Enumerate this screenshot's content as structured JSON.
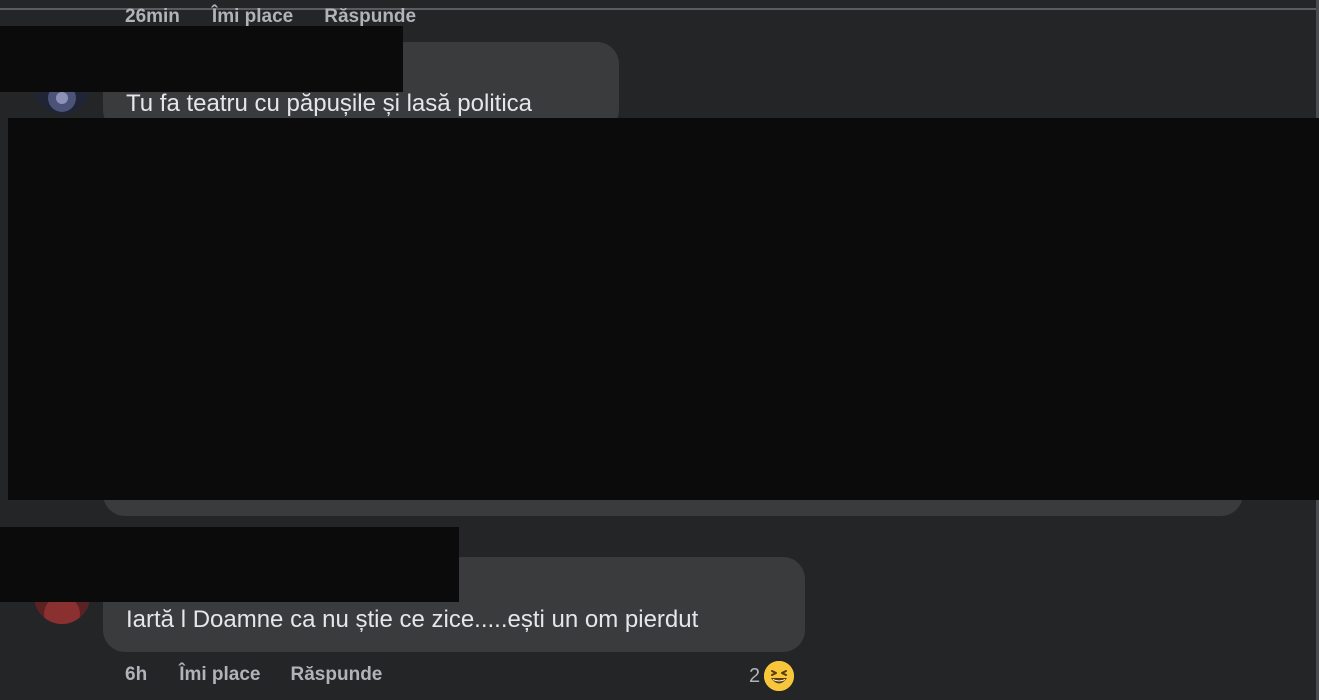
{
  "comment1": {
    "time": "26min",
    "like_label": "Îmi place",
    "reply_label": "Răspunde"
  },
  "comment2": {
    "text": "Tu fa teatru cu păpușile și lasă politica"
  },
  "comment3": {
    "text": "Iartă l Doamne ca nu știe ce zice.....ești un om pierdut",
    "time": "6h",
    "like_label": "Îmi place",
    "reply_label": "Răspunde",
    "reaction_count": "2",
    "reaction_icon": "laughing-emoji-icon"
  },
  "colors": {
    "background": "#242526",
    "bubble": "#3a3b3c",
    "redaction": "#0b0b0c",
    "text": "#e4e6eb",
    "meta_text": "#b0b3b8"
  }
}
